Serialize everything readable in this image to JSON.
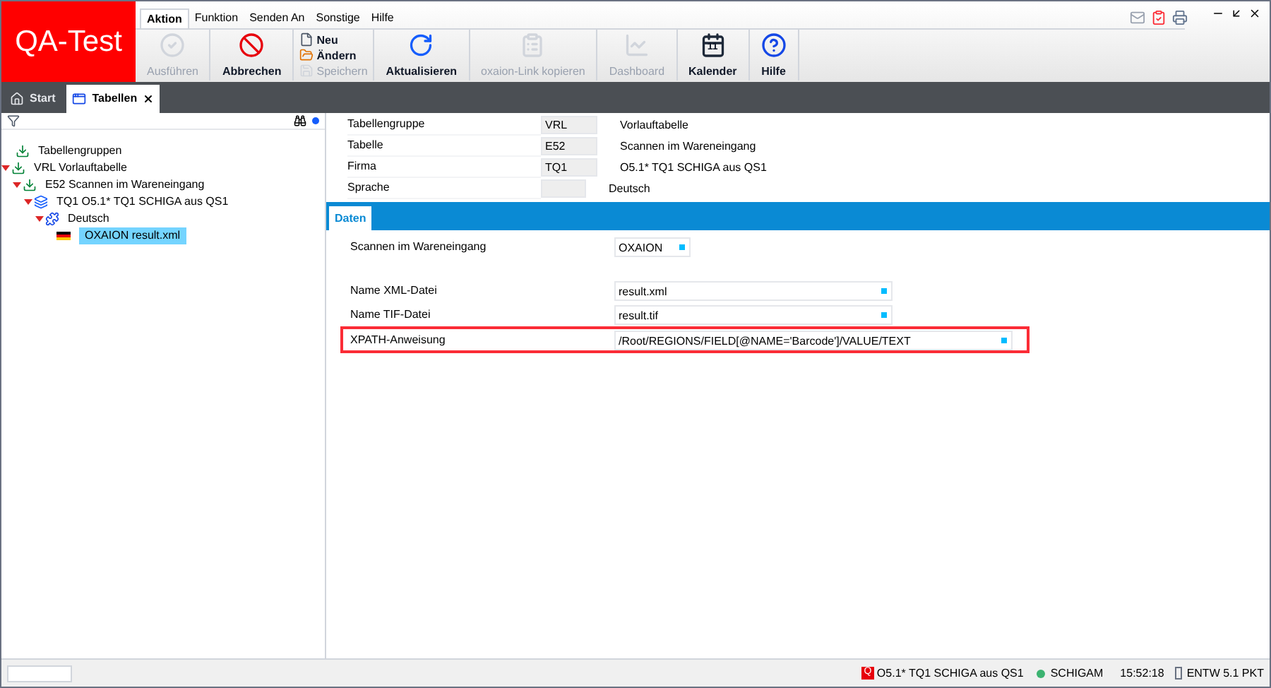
{
  "app": {
    "logo": "QA-Test"
  },
  "menu": [
    {
      "label": "Aktion",
      "selected": true
    },
    {
      "label": "Funktion",
      "selected": false
    },
    {
      "label": "Senden An",
      "selected": false
    },
    {
      "label": "Sonstige",
      "selected": false
    },
    {
      "label": "Hilfe",
      "selected": false
    }
  ],
  "toolbar": [
    {
      "kind": "large",
      "label": "Ausführen",
      "disabled": true
    },
    {
      "kind": "large",
      "label": "Abbrechen",
      "disabled": false
    },
    {
      "kind": "stack",
      "items": [
        {
          "label": "Neu",
          "disabled": false
        },
        {
          "label": "Ändern",
          "disabled": false
        },
        {
          "label": "Speichern",
          "disabled": true
        }
      ]
    },
    {
      "kind": "large",
      "label": "Aktualisieren",
      "disabled": false
    },
    {
      "kind": "large",
      "label": "oxaion-Link kopieren",
      "disabled": true
    },
    {
      "kind": "large",
      "label": "Dashboard",
      "disabled": true
    },
    {
      "kind": "large",
      "label": "Kalender",
      "disabled": false,
      "badge": "11"
    },
    {
      "kind": "large",
      "label": "Hilfe",
      "disabled": false
    }
  ],
  "doc_tabs": [
    {
      "label": "Start",
      "selected": false,
      "closable": false
    },
    {
      "label": "Tabellen",
      "selected": true,
      "closable": true
    }
  ],
  "tree": [
    {
      "label": "Tabellengruppen",
      "selected": false
    },
    {
      "label": "VRL Vorlauftabelle",
      "expanded": true,
      "selected": false,
      "children": [
        {
          "label": "E52 Scannen im Wareneingang",
          "expanded": true,
          "selected": false,
          "children": [
            {
              "label": "TQ1 O5.1* TQ1 SCHIGA aus QS1",
              "expanded": true,
              "selected": false,
              "children": [
                {
                  "label": "Deutsch",
                  "expanded": true,
                  "selected": false,
                  "children": [
                    {
                      "label": "OXAION result.xml",
                      "selected": true
                    }
                  ]
                }
              ]
            }
          ]
        }
      ]
    }
  ],
  "header_fields": [
    {
      "label": "Tabellengruppe",
      "code": "VRL",
      "description": "Vorlauftabelle"
    },
    {
      "label": "Tabelle",
      "code": "E52",
      "description": "Scannen im Wareneingang"
    },
    {
      "label": "Firma",
      "code": "TQ1",
      "description": "O5.1* TQ1 SCHIGA aus QS1"
    },
    {
      "label": "Sprache",
      "description": "Deutsch"
    }
  ],
  "data_tabs": [
    {
      "label": "Daten",
      "selected": true
    }
  ],
  "data_fields": [
    {
      "kind": "select",
      "label": "Scannen im Wareneingang",
      "value": "OXAION",
      "highlighted": false
    },
    {
      "kind": "spacer"
    },
    {
      "kind": "text",
      "label": "Name XML-Datei",
      "value": "result.xml",
      "highlighted": false
    },
    {
      "kind": "text",
      "label": "Name TIF-Datei",
      "value": "result.tif",
      "highlighted": false
    },
    {
      "kind": "wide",
      "label": "XPATH-Anweisung",
      "value": "/Root/REGIONS/FIELD[@NAME='Barcode']/VALUE/TEXT",
      "highlighted": true
    }
  ],
  "status_bar": {
    "company_badge": "Q",
    "company": "O5.1* TQ1 SCHIGA aus QS1",
    "user": "SCHIGAM",
    "time": "15:52:18",
    "environment": "ENTW 5.1 PKT"
  }
}
